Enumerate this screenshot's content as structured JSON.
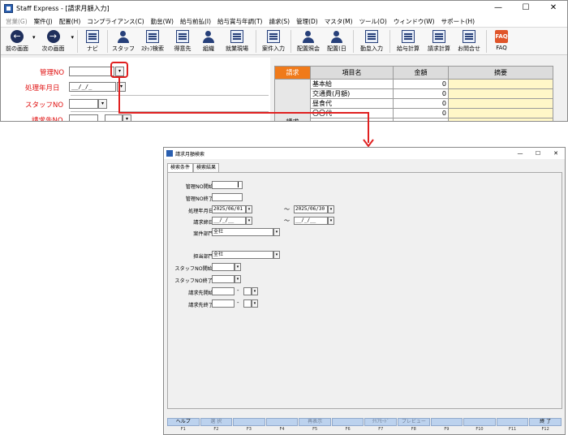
{
  "main_window": {
    "title": "Staff Express - [請求月額入力]",
    "controls": {
      "minimize": "—",
      "maximize": "☐",
      "close": "✕"
    },
    "menu": [
      {
        "label": "営業(G)",
        "disabled": true
      },
      {
        "label": "案件(J)"
      },
      {
        "label": "配置(H)"
      },
      {
        "label": "コンプライアンス(C)"
      },
      {
        "label": "勤怠(W)"
      },
      {
        "label": "給与前払(I)"
      },
      {
        "label": "給与賞与年調(T)"
      },
      {
        "label": "請求(S)"
      },
      {
        "label": "管理(D)"
      },
      {
        "label": "マスタ(M)"
      },
      {
        "label": "ツール(O)"
      },
      {
        "label": "ウィンドウ(W)"
      },
      {
        "label": "サポート(H)"
      }
    ],
    "toolbar": {
      "prev": {
        "label": "前の画面",
        "icon": "←"
      },
      "next": {
        "label": "次の画面",
        "icon": "→"
      },
      "dropdown": "▾",
      "navi": "ナビ",
      "staff": "スタッフ",
      "staff_search": "ｽﾀｯﾌ検索",
      "client": "得意先",
      "org": "組織",
      "site": "就業現場",
      "job_input": "案件入力",
      "assign_view": "配置照会",
      "assign_day": "配置(日",
      "attendance_input": "勤怠入力",
      "salary_calc": "給与計算",
      "billing_calc": "請求計算",
      "inquiry": "お問合せ",
      "faq": "FAQ",
      "faq_icon": "FAQ"
    },
    "form": {
      "mgmt_no_label": "管理NO",
      "proc_date_label": "処理年月日",
      "proc_date_value": "__/_/_",
      "staff_no_label": "スタッフNO",
      "billing_no_label": "請求先NO",
      "dd": "▾"
    },
    "grid": {
      "headers": [
        "請求",
        "項目名",
        "金額",
        "摘要"
      ],
      "side_label": "請求",
      "rows": [
        {
          "name": "基本給",
          "amount": "0"
        },
        {
          "name": "交通費(月額)",
          "amount": "0"
        },
        {
          "name": "昼食代",
          "amount": "0"
        },
        {
          "name": "〇〇代",
          "amount": "0"
        }
      ]
    }
  },
  "dialog": {
    "title": "請求月額検索",
    "controls": {
      "minimize": "—",
      "maximize": "☐",
      "close": "✕"
    },
    "tabs": [
      "検索条件",
      "検索結果"
    ],
    "fields": {
      "mgmt_no_start": {
        "label": "管理NO開始",
        "value": ""
      },
      "mgmt_no_end": {
        "label": "管理NO終了",
        "value": ""
      },
      "proc_date": {
        "label": "処理年月日",
        "from": "2025/06/01",
        "to": "2025/06/30"
      },
      "close_date": {
        "label": "請求締日",
        "from": "__/_/__",
        "to": "__/_/__"
      },
      "job_dept": {
        "label": "案件部門",
        "value": "全社"
      },
      "resp_dept": {
        "label": "担当部門",
        "value": "全社"
      },
      "staff_no_start": {
        "label": "スタッフNO開始",
        "value": ""
      },
      "staff_no_end": {
        "label": "スタッフNO終了",
        "value": ""
      },
      "billing_start": {
        "label": "請求先開始",
        "sep": "-"
      },
      "billing_end": {
        "label": "請求先終了",
        "sep": "-"
      },
      "tilde": "～",
      "dd": "▾"
    },
    "fkeys": [
      {
        "label": "ヘルプ",
        "key": "F1",
        "enabled": true
      },
      {
        "label": "選 択",
        "key": "F2",
        "enabled": false
      },
      {
        "label": "",
        "key": "F3",
        "enabled": true
      },
      {
        "label": "",
        "key": "F4",
        "enabled": true
      },
      {
        "label": "再表示",
        "key": "F5",
        "enabled": false
      },
      {
        "label": "",
        "key": "F6",
        "enabled": true
      },
      {
        "label": "ｸﾘｱﾓｰﾄﾞ",
        "key": "F7",
        "enabled": false
      },
      {
        "label": "プレビュー",
        "key": "F8",
        "enabled": false
      },
      {
        "label": "",
        "key": "F9",
        "enabled": true
      },
      {
        "label": "",
        "key": "F10",
        "enabled": true
      },
      {
        "label": "",
        "key": "F11",
        "enabled": true
      },
      {
        "label": "終 了",
        "key": "F12",
        "enabled": true
      }
    ]
  },
  "colors": {
    "highlight": "#e02020",
    "grid_header_accent": "#f07a1a",
    "fkey_bg": "#bcd2ee"
  }
}
